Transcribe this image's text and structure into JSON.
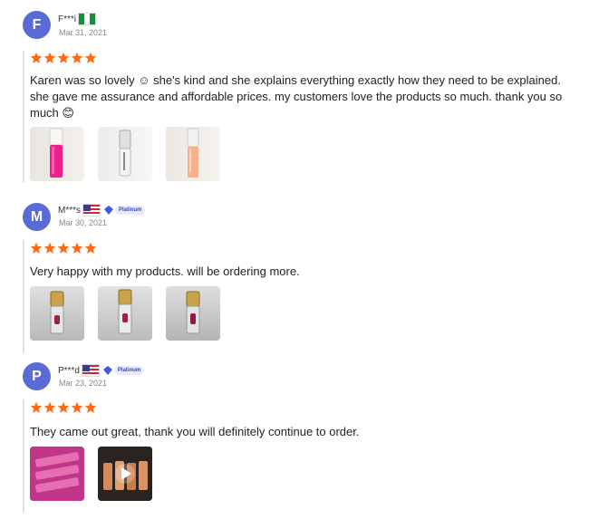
{
  "reviews": [
    {
      "avatar_letter": "F",
      "user": "F***i",
      "flag": "ng",
      "badge": "",
      "date": "Mar 31, 2021",
      "text": "Karen was so lovely ☺ she's kind and she explains everything exactly how they need to be explained. she gave me assurance and affordable prices. my customers love the products so much. thank you so much 😊",
      "photos": [
        "pink-lip-gloss-tube-photo",
        "clear-lip-gloss-tube-photo",
        "peach-lip-gloss-tube-photo"
      ]
    },
    {
      "avatar_letter": "M",
      "user": "M***s",
      "flag": "us",
      "badge": "Platinum",
      "date": "Mar 30, 2021",
      "text": "Very happy with my products. will be ordering more.",
      "photos": [
        "gold-cap-lip-gloss-photo-1",
        "gold-cap-lip-gloss-photo-2",
        "gold-cap-lip-gloss-photo-3"
      ]
    },
    {
      "avatar_letter": "P",
      "user": "P***d",
      "flag": "us",
      "badge": "Platinum",
      "date": "Mar 23, 2021",
      "text": "They came out great, thank you will definitely continue to order.",
      "photos": [
        "pink-packaging-photo",
        "video-thumbnail"
      ]
    }
  ],
  "colors": {
    "avatar": "#5b6bd6",
    "star": "#ff6a1a",
    "badge_bg": "#e8ebff",
    "badge_text": "#3247b8"
  },
  "rating": 5
}
